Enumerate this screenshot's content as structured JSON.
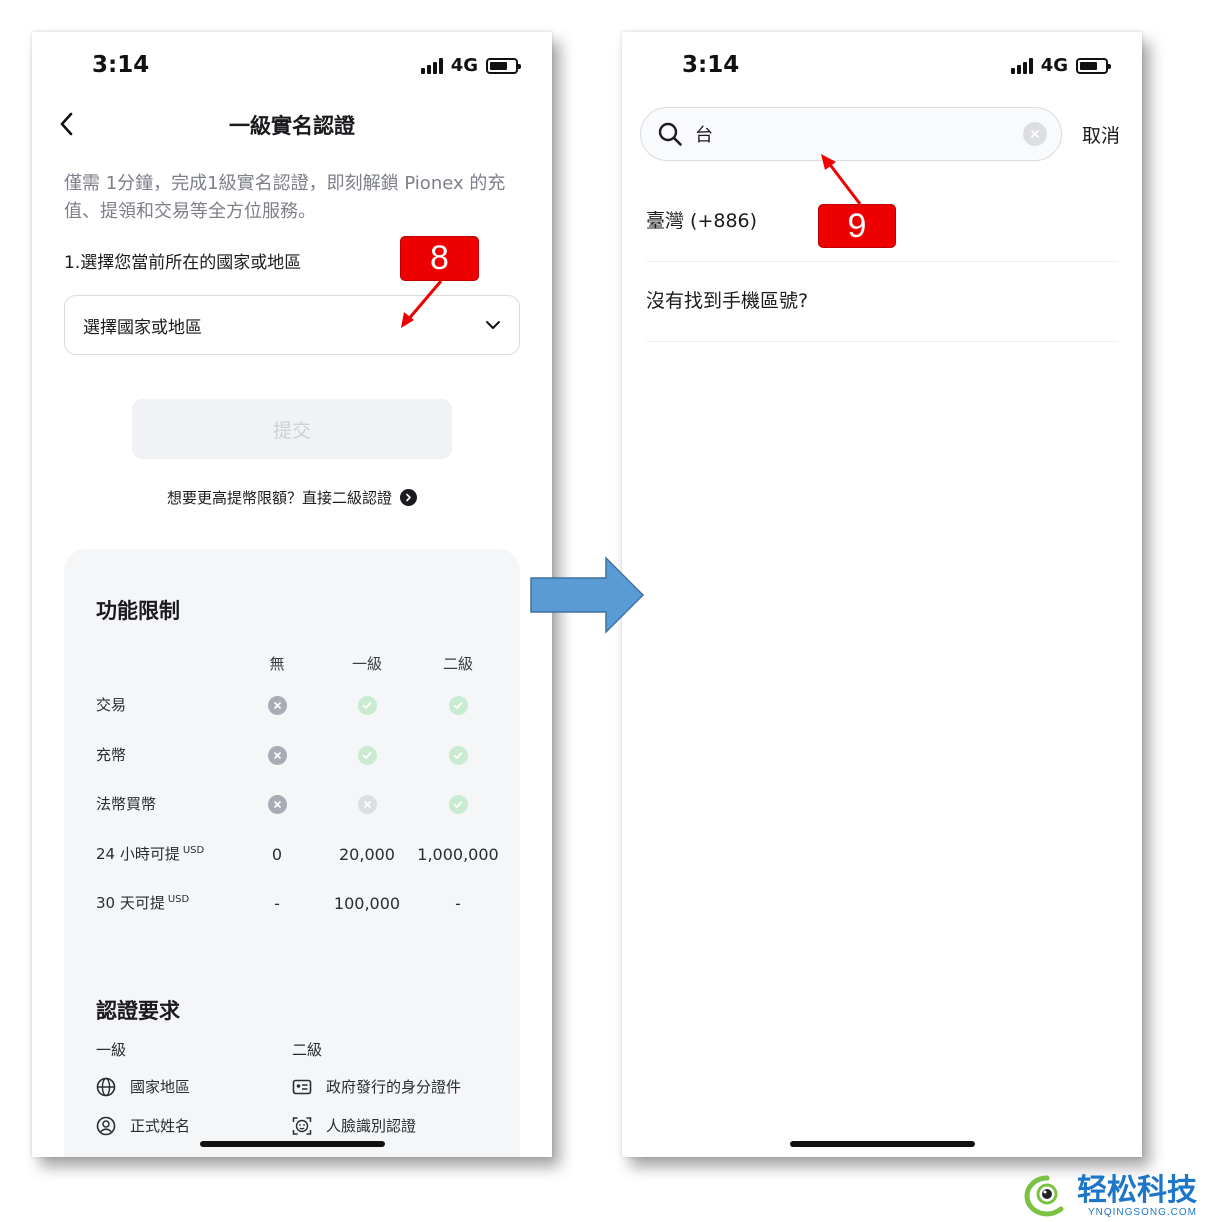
{
  "status": {
    "time": "3:14",
    "network": "4G"
  },
  "left": {
    "title": "一級實名認證",
    "intro": "僅需 1分鐘，完成1級實名認證，即刻解鎖 Pionex 的充值、提領和交易等全方位服務。",
    "step_label": "1.選擇您當前所在的國家或地區",
    "select_placeholder": "選擇國家或地區",
    "submit_label": "提交",
    "level2_link": "想要更高提幣限額？直接二級認證",
    "limits": {
      "title": "功能限制",
      "columns": [
        "無",
        "一級",
        "二級"
      ],
      "rows": [
        {
          "label": "交易",
          "sup": "",
          "values": [
            "x",
            "ok",
            "ok"
          ]
        },
        {
          "label": "充幣",
          "sup": "",
          "values": [
            "x",
            "ok",
            "ok"
          ]
        },
        {
          "label": "法幣買幣",
          "sup": "",
          "values": [
            "x",
            "x-light",
            "ok"
          ]
        },
        {
          "label": "24 小時可提",
          "sup": "USD",
          "values": [
            "0",
            "20,000",
            "1,000,000"
          ]
        },
        {
          "label": "30 天可提",
          "sup": "USD",
          "values": [
            "-",
            "100,000",
            "-"
          ]
        }
      ]
    },
    "requirements": {
      "title": "認證要求",
      "level1_label": "一級",
      "level2_label": "二級",
      "level1_items": [
        {
          "icon": "globe-icon",
          "label": "國家地區"
        },
        {
          "icon": "user-circle-icon",
          "label": "正式姓名"
        }
      ],
      "level2_items": [
        {
          "icon": "id-card-icon",
          "label": "政府發行的身分證件"
        },
        {
          "icon": "face-scan-icon",
          "label": "人臉識別認證"
        }
      ]
    }
  },
  "right": {
    "search_value": "台",
    "cancel_label": "取消",
    "results": [
      "臺灣 (+886)",
      "沒有找到手機區號?"
    ]
  },
  "annotations": {
    "badge_left": "8",
    "badge_right": "9"
  },
  "watermark": {
    "name": "轻松科技",
    "url": "YNQINGSONG.COM"
  },
  "colors": {
    "annotation_red": "#ee0000",
    "arrow_blue": "#5b9bd5",
    "success_green": "#c9ebd2",
    "watermark_blue": "#1e76c8"
  }
}
